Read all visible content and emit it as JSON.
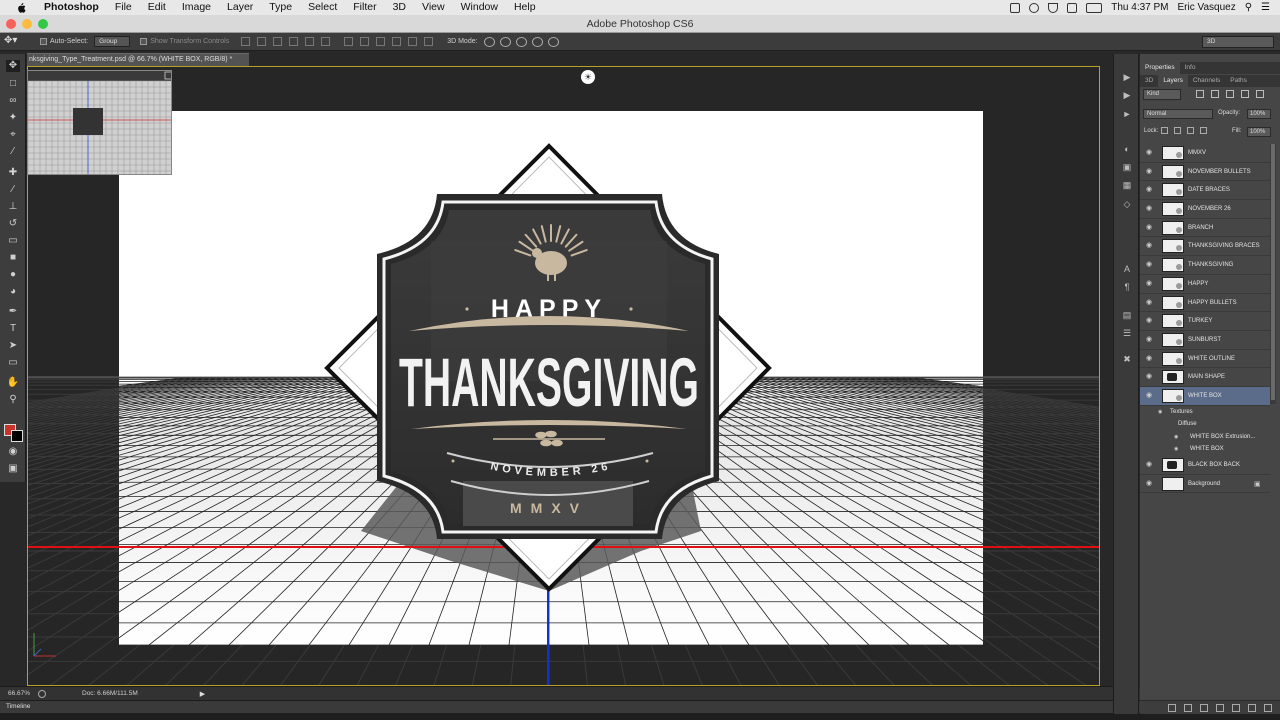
{
  "menubar": {
    "items": [
      {
        "label": "Photoshop",
        "bold": true
      },
      {
        "label": "File"
      },
      {
        "label": "Edit"
      },
      {
        "label": "Image"
      },
      {
        "label": "Layer"
      },
      {
        "label": "Type"
      },
      {
        "label": "Select"
      },
      {
        "label": "Filter"
      },
      {
        "label": "3D"
      },
      {
        "label": "View"
      },
      {
        "label": "Window"
      },
      {
        "label": "Help"
      }
    ],
    "time": "Thu 4:37 PM",
    "user": "Eric Vasquez"
  },
  "window": {
    "title": "Adobe Photoshop CS6",
    "light_colors": [
      "#fc605b",
      "#fdbc40",
      "#34c84a"
    ]
  },
  "options": {
    "auto_select_label": "Auto-Select:",
    "auto_select_value": "Group",
    "show_transform_label": "Show Transform Controls",
    "mode_label": "3D Mode:",
    "workspace": "3D"
  },
  "document": {
    "tab_title": "nksgiving_Type_Treatment.psd @ 66.7% (WHITE BOX, RGB/8) *"
  },
  "artwork": {
    "line1": "HAPPY",
    "line2": "THANKSGIVING",
    "line3": "NOVEMBER 26",
    "line4": "MMXV"
  },
  "status": {
    "zoom": "66.67%",
    "doc": "Doc: 6.66M/111.5M",
    "timeline_label": "Timeline"
  },
  "panels": {
    "top_tabs": [
      "Properties",
      "Info"
    ],
    "layer_tabs": [
      "3D",
      "Layers",
      "Channels",
      "Paths"
    ],
    "kind_label": "Kind",
    "blend_mode": "Normal",
    "opacity_label": "Opacity:",
    "opacity_value": "100%",
    "lock_label": "Lock:",
    "fill_label": "Fill:",
    "fill_value": "100%"
  },
  "layers": [
    {
      "name": "MMXV",
      "type": "3d"
    },
    {
      "name": "NOVEMBER BULLETS",
      "type": "3d"
    },
    {
      "name": "DATE BRACES",
      "type": "3d"
    },
    {
      "name": "NOVEMBER 26",
      "type": "3d"
    },
    {
      "name": "BRANCH",
      "type": "3d"
    },
    {
      "name": "THANKSGIVING BRACES",
      "type": "3d"
    },
    {
      "name": "THANKSGIVING",
      "type": "3d"
    },
    {
      "name": "HAPPY",
      "type": "3d"
    },
    {
      "name": "HAPPY BULLETS",
      "type": "3d"
    },
    {
      "name": "TURKEY",
      "type": "3d"
    },
    {
      "name": "SUNBURST",
      "type": "3d"
    },
    {
      "name": "WHITE OUTLINE",
      "type": "3d"
    },
    {
      "name": "MAIN SHAPE",
      "type": "dark"
    },
    {
      "name": "WHITE BOX",
      "type": "3d",
      "selected": true
    },
    {
      "name": "Textures",
      "type": "sub",
      "indent": 1
    },
    {
      "name": "Diffuse",
      "type": "sub",
      "indent": 2
    },
    {
      "name": "WHITE BOX Extrusion...",
      "type": "sub",
      "indent": 3
    },
    {
      "name": "WHITE BOX",
      "type": "sub",
      "indent": 3
    },
    {
      "name": "BLACK BOX BACK",
      "type": "dark"
    },
    {
      "name": "Background",
      "type": "bg",
      "locked": true
    }
  ]
}
